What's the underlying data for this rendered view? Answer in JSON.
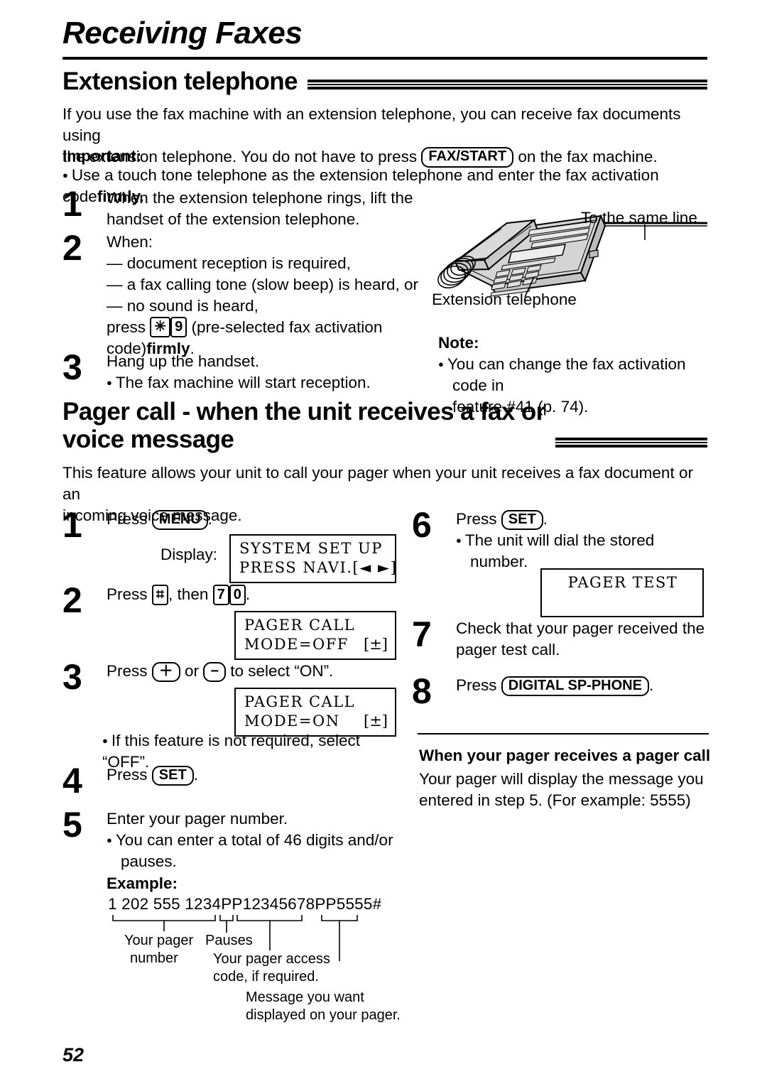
{
  "chapter": {
    "title": "Receiving Faxes"
  },
  "page": {
    "number": "52"
  },
  "section1": {
    "heading": "Extension telephone",
    "intro_a": "If you use the fax machine with an extension telephone, you can receive fax documents using",
    "intro_b_pre": "the extension telephone. You do not have to press",
    "fax_start_key": "FAX/START",
    "intro_b_post": "on the fax machine.",
    "important_label": "Important:",
    "important_text_a": "Use a touch tone telephone as the extension telephone and enter the fax activation code",
    "important_text_b": "firmly.",
    "steps": [
      {
        "num": "1",
        "line1": "When the extension telephone rings, lift the",
        "line2": "handset of the extension telephone."
      },
      {
        "num": "2",
        "line1": "When:",
        "line2": "— document reception is required,",
        "line3": "— a fax calling tone (slow beep) is heard, or",
        "line4": "— no sound is heard,",
        "line5_pre": "press",
        "key1": "✳",
        "key2": "9",
        "line5_post": "(pre-selected fax activation",
        "line6_pre": "code)",
        "line6_bold": "firmly",
        "line6_post": "."
      },
      {
        "num": "3",
        "line1": "Hang up the handset.",
        "line2": "The fax machine will start reception."
      }
    ],
    "illustration": {
      "to_same_line_label": "To the same line",
      "extension_telephone_label": "Extension telephone"
    },
    "note": {
      "label": "Note:",
      "line1": "You can change the fax activation code in",
      "line2": "feature #41 (p. 74)."
    }
  },
  "section2": {
    "heading_line1": "Pager call - when the unit receives a fax or",
    "heading_line2": "voice message",
    "intro_a": "This feature allows your unit to call your pager when your unit receives a fax document or an",
    "intro_b": "incoming voice message.",
    "steps_left": [
      {
        "num": "1",
        "text_pre": "Press",
        "key": "MENU",
        "text_post": ".",
        "display_label": "Display:",
        "lcd_row1": "SYSTEM SET UP",
        "lcd_row2": "PRESS NAVI.[◄ ►]"
      },
      {
        "num": "2",
        "text_pre": "Press",
        "key1": "⌗",
        "text_mid": ", then",
        "key2": "7",
        "key3": "0",
        "text_post": ".",
        "lcd_row1": "PAGER CALL",
        "lcd_row2": "MODE=OFF",
        "lcd_row2_right": "[±]"
      },
      {
        "num": "3",
        "text_pre": "Press",
        "key1": "＋",
        "text_mid": "or",
        "key2": "−",
        "text_post": "to select “ON”.",
        "lcd_row1": "PAGER CALL",
        "lcd_row2": "MODE=ON",
        "lcd_row2_right": "[±]",
        "note_bullet": "If this feature is not required, select “OFF”."
      },
      {
        "num": "4",
        "text_pre": "Press",
        "key": "SET",
        "text_post": "."
      },
      {
        "num": "5",
        "line1": "Enter your pager number.",
        "line2a": "You can enter a total of 46 digits and/or",
        "line2b": "pauses.",
        "example_label": "Example:",
        "example_number": "1 202 555 1234PP12345678PP5555#",
        "bracket_labels": {
          "pager_number_l1": "Your pager",
          "pager_number_l2": "number",
          "pauses": "Pauses",
          "access_code_l1": "Your pager access",
          "access_code_l2": "code, if required.",
          "message_l1": "Message you want",
          "message_l2": "displayed on your pager."
        }
      }
    ],
    "steps_right": [
      {
        "num": "6",
        "text_pre": "Press",
        "key": "SET",
        "text_post": ".",
        "bullet_l1": "The unit will dial the stored",
        "bullet_l2": "number.",
        "lcd_row1": "PAGER TEST"
      },
      {
        "num": "7",
        "line1": "Check that your pager received the",
        "line2": "pager test call."
      },
      {
        "num": "8",
        "text_pre": "Press",
        "key": "DIGITAL SP-PHONE",
        "text_post": "."
      }
    ],
    "pager_receives": {
      "heading": "When your pager receives a pager call",
      "line1": "Your pager will display the message you",
      "line2": "entered in step 5. (For example: 5555)"
    }
  },
  "colors": {
    "ink": "#000000",
    "paper": "#ffffff",
    "phone_fill": "#d4d4d4"
  }
}
